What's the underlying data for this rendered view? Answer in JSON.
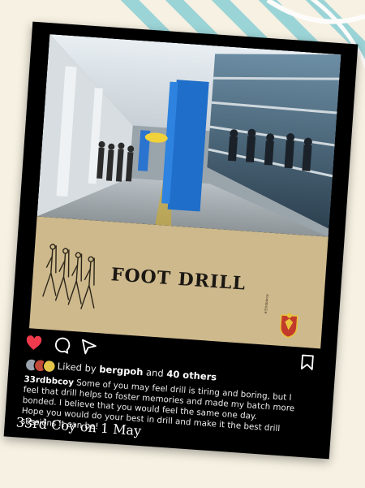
{
  "banner": {
    "title": "FOOT DRILL",
    "hashtag": "#33rdbbcoy"
  },
  "post": {
    "icons": [
      "heart-icon",
      "comment-icon",
      "share-icon",
      "bookmark-icon"
    ],
    "liked_prefix": "Liked by",
    "liked_user": "bergpoh",
    "liked_and": "and",
    "liked_others": "40 others",
    "caption_user": "33rdbbcoy",
    "caption_text": "Some of you may feel drill is tiring and boring, but I feel that drill helps to foster memories and made my batch more bonded. I believe that you would feel the same one day.",
    "caption_text_2": "Hope you would do your best in drill and make it the best drill sessions it can be!",
    "date_label": "33rd Coy on 1 May"
  },
  "colors": {
    "background": "#f6f1e2",
    "stripe": "#8ccfd6",
    "card": "#000000",
    "banner": "#cdb98c",
    "heart": "#ed3a4d"
  }
}
